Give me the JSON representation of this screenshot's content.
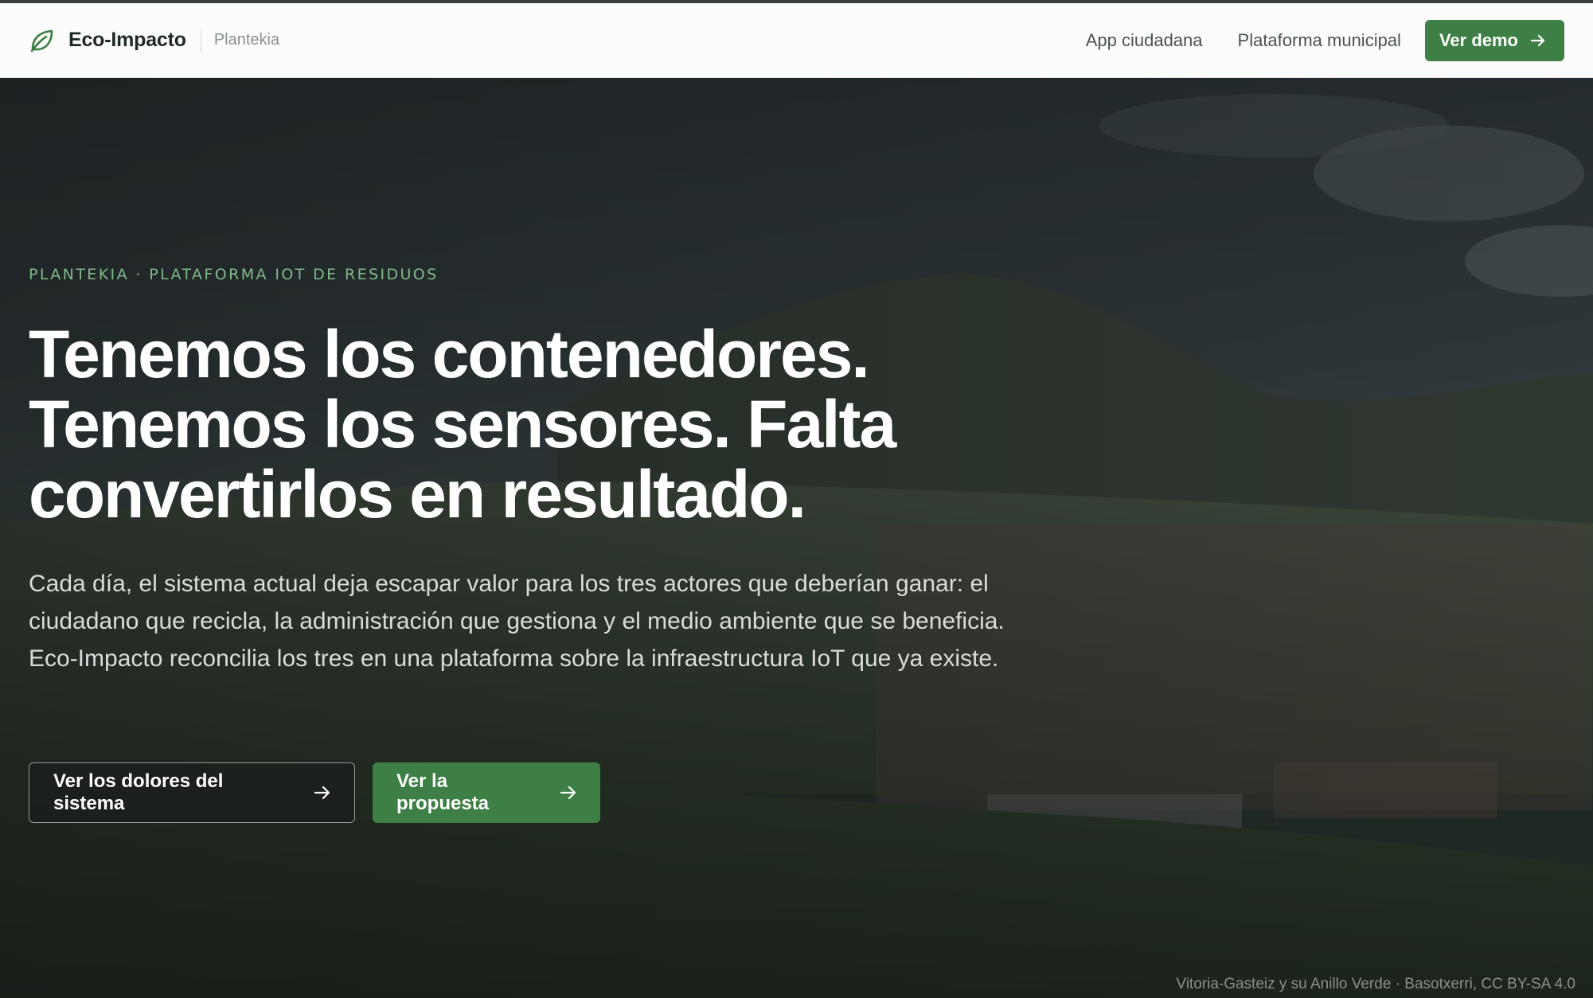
{
  "header": {
    "brand_name": "Eco-Impacto",
    "brand_sub": "Plantekia",
    "logo_icon": "leaf-icon",
    "nav": [
      {
        "label": "App ciudadana"
      },
      {
        "label": "Plataforma municipal"
      }
    ],
    "demo_label": "Ver demo",
    "demo_icon": "arrow-right-icon"
  },
  "hero": {
    "eyebrow": "PLANTEKIA · PLATAFORMA IOT DE RESIDUOS",
    "headline_lines": [
      "Tenemos los contenedores.",
      "Tenemos los sensores. Falta",
      "convertirlos en resultado."
    ],
    "lead": "Cada día, el sistema actual deja escapar valor para los tres actores que deberían ganar: el ciudadano que recicla, la administración que gestiona y el medio ambiente que se beneficia. Eco-Impacto reconcilia los tres en una plataforma sobre la infraestructura IoT que ya existe.",
    "cta_secondary": "Ver los dolores del sistema",
    "cta_primary": "Ver la propuesta",
    "photo_credit": "Vitoria-Gasteiz y su Anillo Verde · Basotxerri, CC BY-SA 4.0"
  },
  "colors": {
    "accent": "#3d7f44",
    "eyebrow": "#7fb98a",
    "header_bg": "#fbfcfb"
  }
}
